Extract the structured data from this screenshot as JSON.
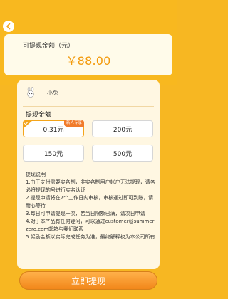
{
  "colors": {
    "background": "#f7b722",
    "accent": "#f39a0c",
    "button": "#f2871a",
    "newbie_tag": "#f17b2b"
  },
  "header": {
    "back_icon": "chevron-left-icon"
  },
  "balance": {
    "label": "可提现金额（元）",
    "amount": "￥88.00"
  },
  "user": {
    "avatar_icon": "bunny-avatar-icon",
    "name": "小兔"
  },
  "withdraw": {
    "title": "提现金额",
    "options": [
      {
        "label": "0.31元",
        "selected": true,
        "tag": "新人专享"
      },
      {
        "label": "200元",
        "selected": false
      },
      {
        "label": "150元",
        "selected": false
      },
      {
        "label": "500元",
        "selected": false
      }
    ]
  },
  "description": {
    "title": "提现说明",
    "items": [
      "1.由于支付需要实名制，非实名制用户帐户无法提现，请务必将提现的号进行实名认证",
      "2.提现申请将在7个工作日内审核，审核通过即可到账，请耐心等待",
      "3.每日可申请提现一次，若当日限额已满，请次日申请",
      "4.对于本产品有任何疑问，可以通过customer@summerzero.com邮箱与我们联系",
      "5.奖励金额以实际完成任务为准，最终解释权为本公司所有"
    ]
  },
  "action": {
    "button_label": "立即提现"
  }
}
